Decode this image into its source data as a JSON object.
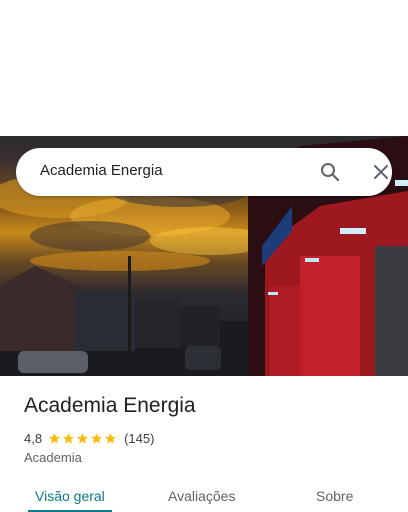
{
  "search": {
    "query": "Academia Energia"
  },
  "place": {
    "name": "Academia Energia",
    "rating": "4,8",
    "stars": 5,
    "review_count": "(145)",
    "category": "Academia"
  },
  "tabs": [
    {
      "label": "Visão geral",
      "active": true
    },
    {
      "label": "Avaliações",
      "active": false
    },
    {
      "label": "Sobre",
      "active": false
    }
  ],
  "icons": {
    "search": "search-icon",
    "close": "close-icon",
    "star": "star-icon"
  },
  "colors": {
    "accent": "#0b7a8a",
    "star": "#fbbc04",
    "text_primary": "#202124",
    "text_secondary": "#5f6368"
  }
}
